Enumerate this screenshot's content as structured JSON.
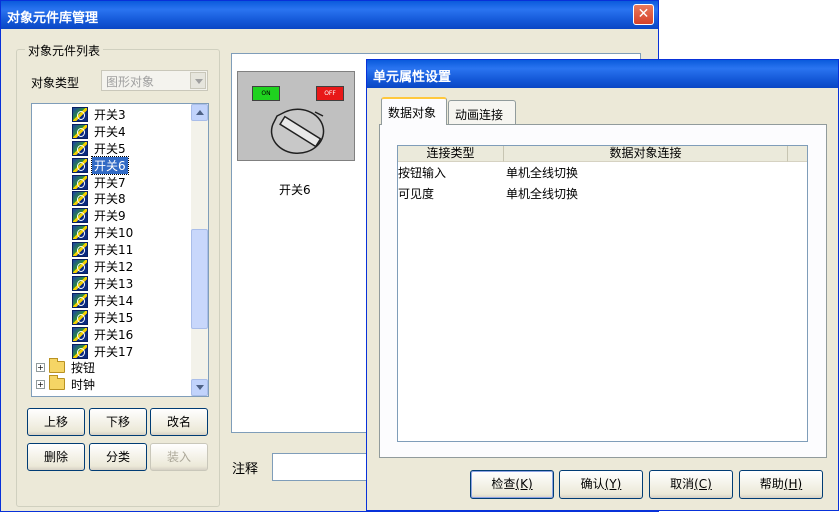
{
  "lib_window": {
    "title": "对象元件库管理",
    "group_title": "对象元件列表",
    "type_label": "对象类型",
    "type_value": "图形对象",
    "tree_switches": [
      "开关3",
      "开关4",
      "开关5",
      "开关6",
      "开关7",
      "开关8",
      "开关9",
      "开关10",
      "开关11",
      "开关12",
      "开关13",
      "开关14",
      "开关15",
      "开关16",
      "开关17"
    ],
    "selected_item": "开关6",
    "tree_folders": [
      "按钮",
      "时钟"
    ],
    "buttons": {
      "move_up": "上移",
      "move_down": "下移",
      "rename": "改名",
      "delete": "删除",
      "classify": "分类",
      "load": "装入"
    },
    "preview_caption": "开关6",
    "preview_on_label": "ON",
    "preview_off_label": "OFF",
    "comment_label": "注释"
  },
  "prop_dialog": {
    "title": "单元属性设置",
    "tabs": [
      "数据对象",
      "动画连接"
    ],
    "active_tab": "数据对象",
    "columns": [
      "连接类型",
      "数据对象连接"
    ],
    "rows": [
      {
        "type": "按钮输入",
        "link": "单机全线切换"
      },
      {
        "type": "可见度",
        "link": "单机全线切换"
      }
    ],
    "buttons": {
      "check": "检查",
      "check_key": "(K)",
      "confirm": "确认",
      "confirm_key": "(Y)",
      "cancel": "取消",
      "cancel_key": "(C)",
      "help": "帮助",
      "help_key": "(H)"
    }
  },
  "colors": {
    "title_bar": "#0a5bdc",
    "selection": "#316ac5",
    "on_led": "#1fd21f",
    "off_led": "#e81818"
  }
}
